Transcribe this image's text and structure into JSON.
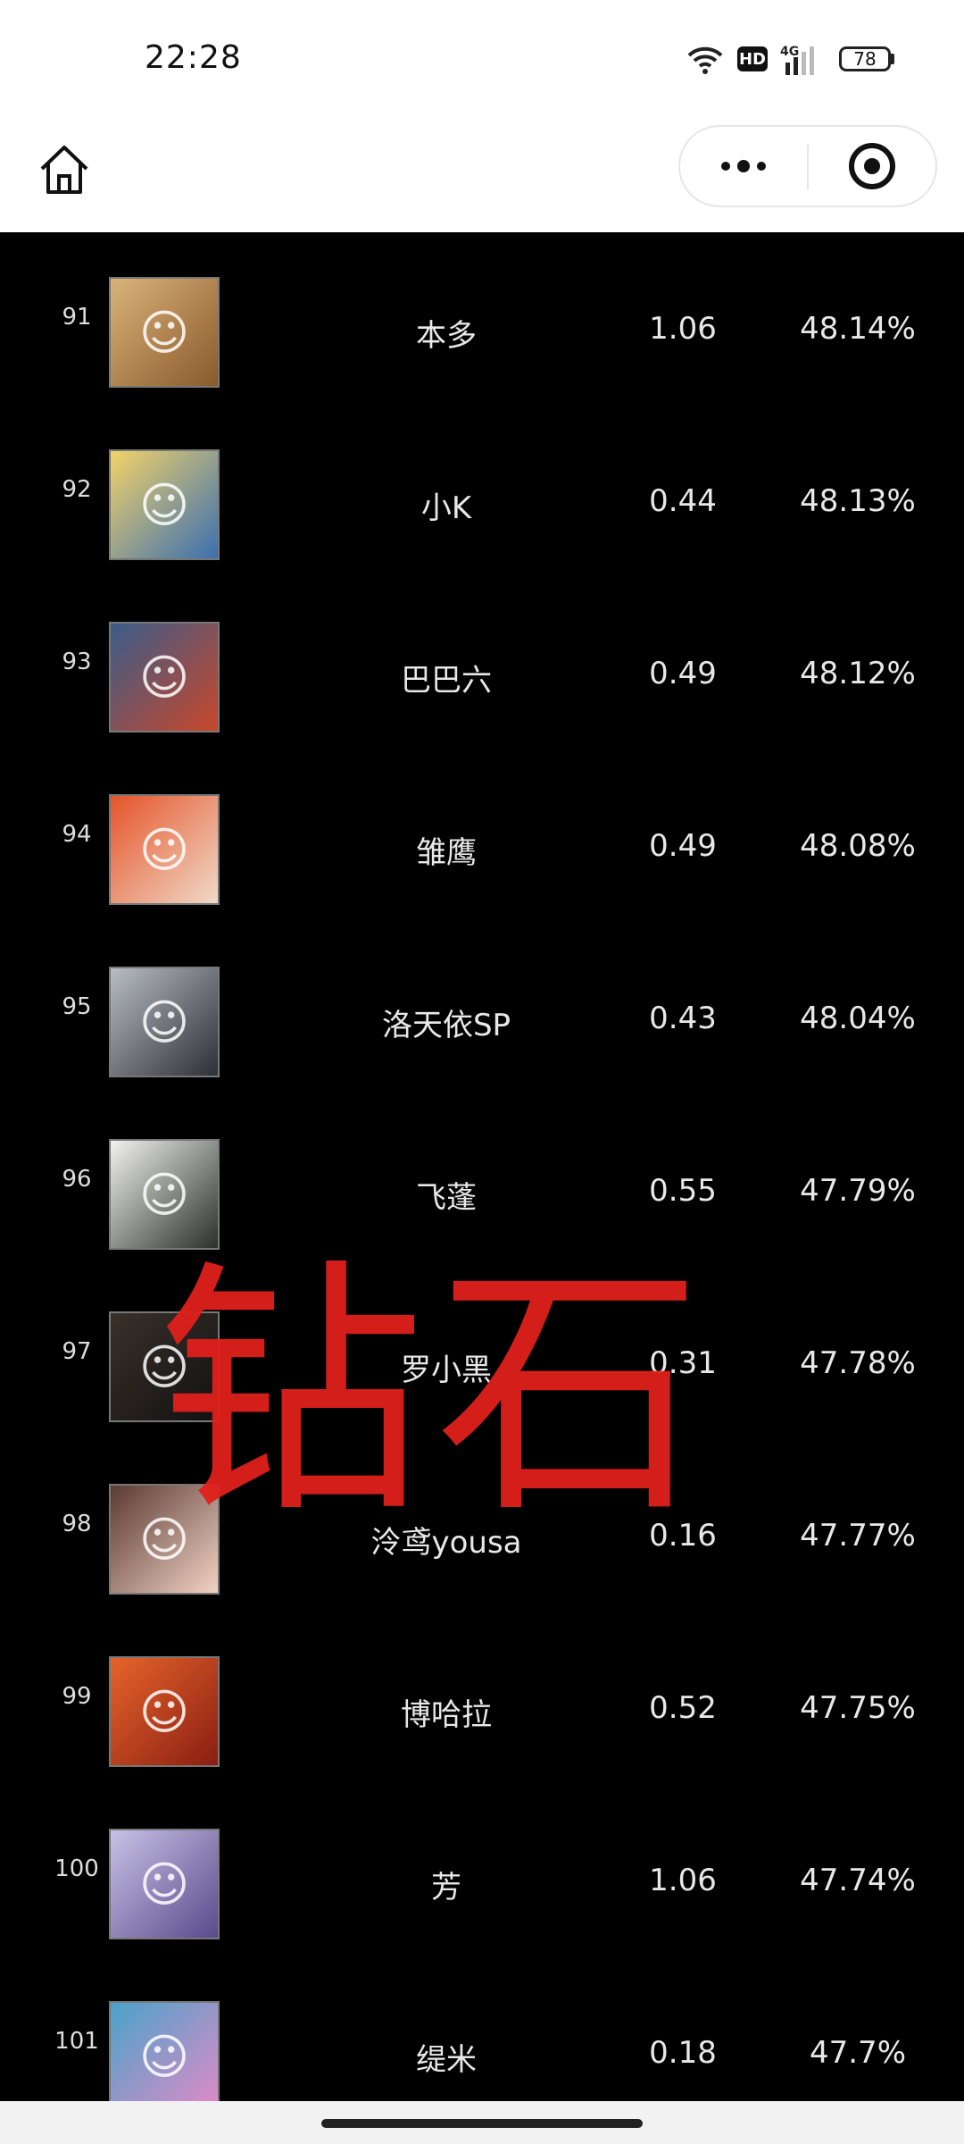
{
  "status_bar": {
    "time": "22:28",
    "hd_label": "HD",
    "network_label": "4G",
    "battery": "78"
  },
  "nav": {
    "home_icon": "home-icon",
    "more_icon": "more-dots-icon",
    "close_icon": "target-circle-icon"
  },
  "rows": [
    {
      "rank": "91",
      "name": "本多",
      "score": "1.06",
      "rate": "48.14%",
      "color": "#b48a4a"
    },
    {
      "rank": "92",
      "name": "小K",
      "score": "0.44",
      "rate": "48.13%",
      "color": "#4a79b6"
    },
    {
      "rank": "93",
      "name": "巴巴六",
      "score": "0.49",
      "rate": "48.12%",
      "color": "#a8462d"
    },
    {
      "rank": "94",
      "name": "雏鹰",
      "score": "0.49",
      "rate": "48.08%",
      "color": "#d8502a"
    },
    {
      "rank": "95",
      "name": "洛天依SP",
      "score": "0.43",
      "rate": "48.04%",
      "color": "#7a7f86"
    },
    {
      "rank": "96",
      "name": "飞蓬",
      "score": "0.55",
      "rate": "47.79%",
      "color": "#5a6a5e"
    },
    {
      "rank": "97",
      "name": "罗小黑",
      "score": "0.31",
      "rate": "47.78%",
      "color": "#2b2420"
    },
    {
      "rank": "98",
      "name": "泠鸢yousa",
      "score": "0.16",
      "rate": "47.77%",
      "color": "#8f5a4e"
    },
    {
      "rank": "99",
      "name": "博哈拉",
      "score": "0.52",
      "rate": "47.75%",
      "color": "#c8461e"
    },
    {
      "rank": "100",
      "name": "芳",
      "score": "1.06",
      "rate": "47.74%",
      "color": "#8a86c2"
    },
    {
      "rank": "101",
      "name": "缇米",
      "score": "0.18",
      "rate": "47.7%",
      "color": "#c67ab8"
    }
  ],
  "watermark": "钻石"
}
